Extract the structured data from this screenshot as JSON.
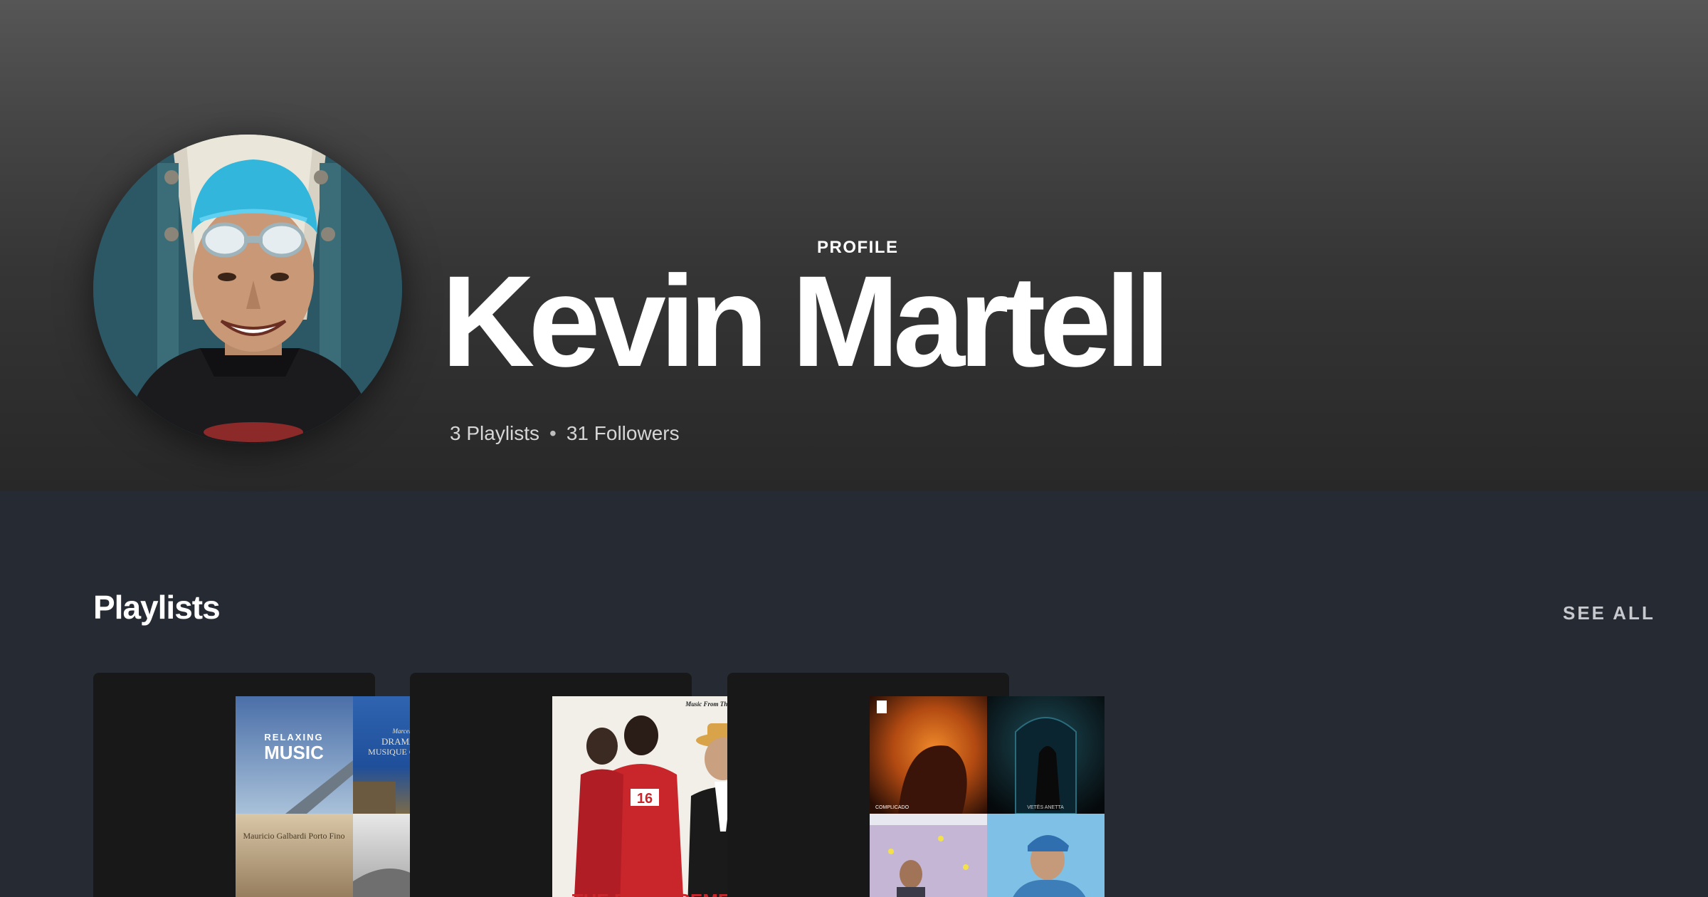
{
  "profile": {
    "type_label": "PROFILE",
    "name": "Kevin Martell",
    "playlists_count": "3 Playlists",
    "separator": "•",
    "followers_count": "31 Followers",
    "avatar_icon": "user-avatar-photo"
  },
  "playlists_section": {
    "title": "Playlists",
    "see_all_label": "SEE ALL",
    "cards": [
      {
        "cover_tiles": [
          {
            "line1": "RELAXING",
            "line2": "MUSIC"
          },
          {
            "line1": "Marcel Dupont",
            "line2": "DRAMATIQUE",
            "line3": "MUSIQUE CLASSIQUE"
          },
          {
            "line1": "Mauricio Galbardi Porto Fino"
          },
          {
            "line1": ""
          }
        ]
      },
      {
        "cover_caption": "Music From The Motion Picture",
        "cover_title": "THE REPLACEMENTS"
      },
      {
        "cover_tiles": [
          {
            "line1": "COMPLICADO"
          },
          {
            "line1": "VETËS ANETTA"
          },
          {
            "line1": ""
          },
          {
            "line1": ""
          }
        ]
      }
    ]
  },
  "colors": {
    "header_top": "#565656",
    "header_bottom": "#282828",
    "body_background": "#262a33",
    "card_background": "#181818"
  }
}
